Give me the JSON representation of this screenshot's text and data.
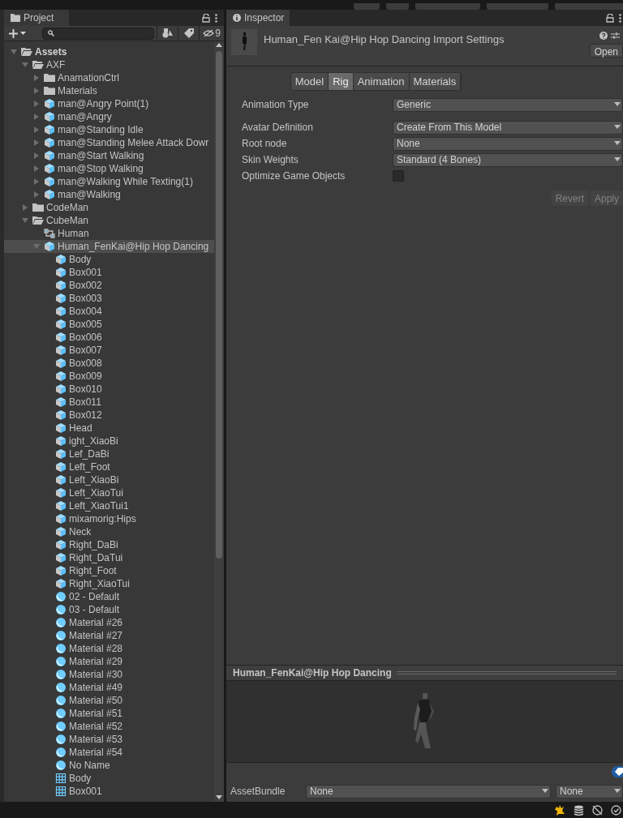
{
  "project": {
    "tab": "Project",
    "hidden_count": "9",
    "tree": [
      {
        "label": "Assets",
        "kind": "folder",
        "expanded": true,
        "selected": false,
        "children": [
          {
            "label": "AXF",
            "kind": "folder",
            "expanded": true,
            "selected": false,
            "children": [
              {
                "label": "AnamationCtrl",
                "kind": "folder",
                "expanded": false,
                "selected": false
              },
              {
                "label": "Materials",
                "kind": "folder",
                "expanded": false,
                "selected": false
              },
              {
                "label": "man@Angry Point(1)",
                "kind": "model",
                "expanded": false,
                "selected": false
              },
              {
                "label": "man@Angry",
                "kind": "model",
                "expanded": false,
                "selected": false
              },
              {
                "label": "man@Standing Idle",
                "kind": "model",
                "expanded": false,
                "selected": false
              },
              {
                "label": "man@Standing Melee Attack Dowr",
                "kind": "model",
                "expanded": false,
                "selected": false
              },
              {
                "label": "man@Start Walking",
                "kind": "model",
                "expanded": false,
                "selected": false
              },
              {
                "label": "man@Stop Walking",
                "kind": "model",
                "expanded": false,
                "selected": false
              },
              {
                "label": "man@Walking While Texting(1)",
                "kind": "model",
                "expanded": false,
                "selected": false
              },
              {
                "label": "man@Walking",
                "kind": "model",
                "expanded": false,
                "selected": false
              }
            ]
          },
          {
            "label": "CodeMan",
            "kind": "folder",
            "expanded": false,
            "selected": false
          },
          {
            "label": "CubeMan",
            "kind": "folder",
            "expanded": true,
            "selected": false,
            "children": [
              {
                "label": "Human",
                "kind": "avatar",
                "selected": false
              },
              {
                "label": "Human_FenKai@Hip Hop Dancing",
                "kind": "model",
                "expanded": true,
                "selected": true,
                "children": [
                  {
                    "label": "Body",
                    "kind": "part",
                    "selected": false
                  },
                  {
                    "label": "Box001",
                    "kind": "part",
                    "selected": false
                  },
                  {
                    "label": "Box002",
                    "kind": "part",
                    "selected": false
                  },
                  {
                    "label": "Box003",
                    "kind": "part",
                    "selected": false
                  },
                  {
                    "label": "Box004",
                    "kind": "part",
                    "selected": false
                  },
                  {
                    "label": "Box005",
                    "kind": "part",
                    "selected": false
                  },
                  {
                    "label": "Box006",
                    "kind": "part",
                    "selected": false
                  },
                  {
                    "label": "Box007",
                    "kind": "part",
                    "selected": false
                  },
                  {
                    "label": "Box008",
                    "kind": "part",
                    "selected": false
                  },
                  {
                    "label": "Box009",
                    "kind": "part",
                    "selected": false
                  },
                  {
                    "label": "Box010",
                    "kind": "part",
                    "selected": false
                  },
                  {
                    "label": "Box011",
                    "kind": "part",
                    "selected": false
                  },
                  {
                    "label": "Box012",
                    "kind": "part",
                    "selected": false
                  },
                  {
                    "label": "Head",
                    "kind": "part",
                    "selected": false
                  },
                  {
                    "label": "ight_XiaoBi",
                    "kind": "part",
                    "selected": false
                  },
                  {
                    "label": "Lef_DaBi",
                    "kind": "part",
                    "selected": false
                  },
                  {
                    "label": "Left_Foot",
                    "kind": "part",
                    "selected": false
                  },
                  {
                    "label": "Left_XiaoBi",
                    "kind": "part",
                    "selected": false
                  },
                  {
                    "label": "Left_XiaoTui",
                    "kind": "part",
                    "selected": false
                  },
                  {
                    "label": "Left_XiaoTui1",
                    "kind": "part",
                    "selected": false
                  },
                  {
                    "label": "mixamorig:Hips",
                    "kind": "part",
                    "selected": false
                  },
                  {
                    "label": "Neck",
                    "kind": "part",
                    "selected": false
                  },
                  {
                    "label": "Right_DaBi",
                    "kind": "part",
                    "selected": false
                  },
                  {
                    "label": "Right_DaTui",
                    "kind": "part",
                    "selected": false
                  },
                  {
                    "label": "Right_Foot",
                    "kind": "part",
                    "selected": false
                  },
                  {
                    "label": "Right_XiaoTui",
                    "kind": "part",
                    "selected": false
                  },
                  {
                    "label": "02 - Default",
                    "kind": "material",
                    "selected": false
                  },
                  {
                    "label": "03 - Default",
                    "kind": "material",
                    "selected": false
                  },
                  {
                    "label": "Material #26",
                    "kind": "material",
                    "selected": false
                  },
                  {
                    "label": "Material #27",
                    "kind": "material",
                    "selected": false
                  },
                  {
                    "label": "Material #28",
                    "kind": "material",
                    "selected": false
                  },
                  {
                    "label": "Material #29",
                    "kind": "material",
                    "selected": false
                  },
                  {
                    "label": "Material #30",
                    "kind": "material",
                    "selected": false
                  },
                  {
                    "label": "Material #49",
                    "kind": "material",
                    "selected": false
                  },
                  {
                    "label": "Material #50",
                    "kind": "material",
                    "selected": false
                  },
                  {
                    "label": "Material #51",
                    "kind": "material",
                    "selected": false
                  },
                  {
                    "label": "Material #52",
                    "kind": "material",
                    "selected": false
                  },
                  {
                    "label": "Material #53",
                    "kind": "material",
                    "selected": false
                  },
                  {
                    "label": "Material #54",
                    "kind": "material",
                    "selected": false
                  },
                  {
                    "label": "No Name",
                    "kind": "material",
                    "selected": false
                  },
                  {
                    "label": "Body",
                    "kind": "mesh",
                    "selected": false
                  },
                  {
                    "label": "Box001",
                    "kind": "mesh",
                    "selected": false
                  }
                ]
              }
            ]
          }
        ]
      }
    ]
  },
  "inspector": {
    "tab": "Inspector",
    "title": "Human_Fen Kai@Hip Hop Dancing Import Settings",
    "open_button": "Open",
    "tabs": [
      {
        "label": "Model",
        "selected": false
      },
      {
        "label": "Rig",
        "selected": true
      },
      {
        "label": "Animation",
        "selected": false
      },
      {
        "label": "Materials",
        "selected": false
      }
    ],
    "fields": [
      {
        "label": "Animation Type",
        "kind": "dropdown",
        "value": "Generic"
      },
      {
        "label": "Avatar Definition",
        "kind": "dropdown",
        "value": "Create From This Model"
      },
      {
        "label": "Root node",
        "kind": "dropdown",
        "value": "None"
      },
      {
        "label": "Skin Weights",
        "kind": "dropdown",
        "value": "Standard (4 Bones)"
      },
      {
        "label": "Optimize Game Objects",
        "kind": "checkbox",
        "checked": false
      }
    ],
    "buttons": [
      {
        "label": "Revert",
        "disabled": true
      },
      {
        "label": "Apply",
        "disabled": true
      }
    ],
    "preview": {
      "title": "Human_FenKai@Hip Hop Dancing"
    },
    "asset_bundle": {
      "label": "AssetBundle",
      "name": "None",
      "variant": "None"
    }
  }
}
